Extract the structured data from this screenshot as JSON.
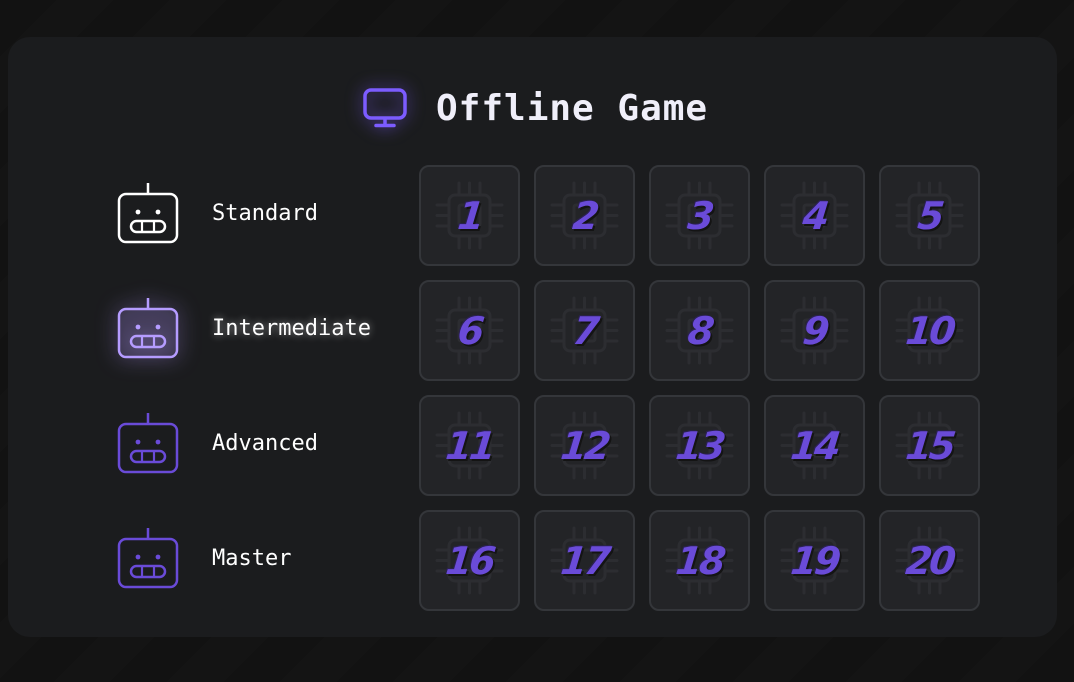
{
  "header": {
    "title": "Offline Game",
    "icon": "monitor-icon",
    "accent": "#7c5cff"
  },
  "levels": [
    {
      "label": "Standard",
      "icon": "robot-icon",
      "color": "#ffffff",
      "active": false
    },
    {
      "label": "Intermediate",
      "icon": "robot-icon",
      "color": "#b59cff",
      "active": true
    },
    {
      "label": "Advanced",
      "icon": "robot-icon",
      "color": "#6a4bd8",
      "active": false
    },
    {
      "label": "Master",
      "icon": "robot-icon",
      "color": "#6a4bd8",
      "active": false
    }
  ],
  "stages": [
    "1",
    "2",
    "3",
    "4",
    "5",
    "6",
    "7",
    "8",
    "9",
    "10",
    "11",
    "12",
    "13",
    "14",
    "15",
    "16",
    "17",
    "18",
    "19",
    "20"
  ],
  "stage_icon": "cpu-chip-icon",
  "colors": {
    "panel": "#1b1c1e",
    "cell": "#232427",
    "cell_border": "#34363a",
    "number": "#6a4bd8"
  }
}
